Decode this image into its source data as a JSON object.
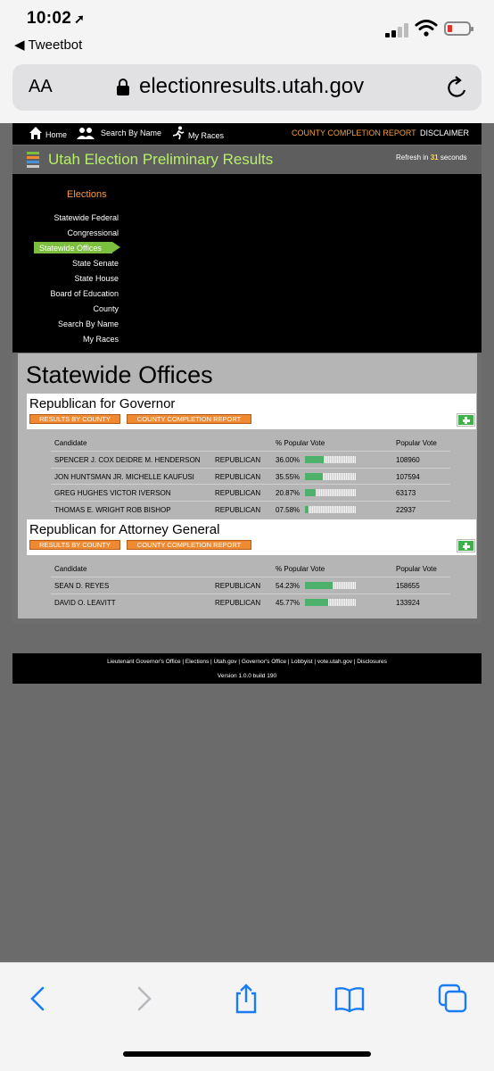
{
  "status": {
    "time": "10:02",
    "back_app": "Tweetbot"
  },
  "browser": {
    "aa": "AA",
    "url": "electionresults.utah.gov"
  },
  "nav": {
    "home": "Home",
    "search_by_name": "Search By Name",
    "my_races": "My Races",
    "county_completion": "COUNTY COMPLETION REPORT",
    "disclaimer": "DISCLAIMER"
  },
  "header": {
    "title": "Utah Election Preliminary Results",
    "refresh_prefix": "Refresh in",
    "refresh_seconds": "31",
    "refresh_suffix": "seconds"
  },
  "sidebar": {
    "heading": "Elections",
    "items": [
      {
        "label": "Statewide Federal"
      },
      {
        "label": "Congressional"
      },
      {
        "label": "Statewide Offices"
      },
      {
        "label": "State Senate"
      },
      {
        "label": "State House"
      },
      {
        "label": "Board of Education"
      },
      {
        "label": "County"
      },
      {
        "label": "Search By Name"
      },
      {
        "label": "My Races"
      }
    ],
    "active_index": 2
  },
  "main": {
    "heading": "Statewide Offices",
    "columns": {
      "candidate": "Candidate",
      "pct": "% Popular Vote",
      "votes": "Popular Vote"
    },
    "buttons": {
      "by_county": "RESULTS BY COUNTY",
      "completion": "COUNTY COMPLETION REPORT"
    },
    "races": [
      {
        "title": "Republican for Governor",
        "candidates": [
          {
            "name": "SPENCER J. COX DEIDRE M. HENDERSON",
            "party": "REPUBLICAN",
            "pct_text": "36.00%",
            "pct": 36.0,
            "votes": "108960"
          },
          {
            "name": "JON HUNTSMAN JR. MICHELLE KAUFUSI",
            "party": "REPUBLICAN",
            "pct_text": "35.55%",
            "pct": 35.55,
            "votes": "107594"
          },
          {
            "name": "GREG HUGHES VICTOR IVERSON",
            "party": "REPUBLICAN",
            "pct_text": "20.87%",
            "pct": 20.87,
            "votes": "63173"
          },
          {
            "name": "THOMAS E. WRIGHT ROB BISHOP",
            "party": "REPUBLICAN",
            "pct_text": "07.58%",
            "pct": 7.58,
            "votes": "22937"
          }
        ]
      },
      {
        "title": "Republican for Attorney General",
        "candidates": [
          {
            "name": "SEAN D. REYES",
            "party": "REPUBLICAN",
            "pct_text": "54.23%",
            "pct": 54.23,
            "votes": "158655"
          },
          {
            "name": "DAVID O. LEAVITT",
            "party": "REPUBLICAN",
            "pct_text": "45.77%",
            "pct": 45.77,
            "votes": "133924"
          }
        ]
      }
    ]
  },
  "footer": {
    "links": "Lieutenant Governor's Office | Elections | Utah.gov | Governor's Office | Lobbyist | vote.utah.gov | Disclosures",
    "version": "Version 1.0.0 build 190"
  },
  "colors": {
    "title_green": "#b6ef6a",
    "accent_orange": "#ef8a33",
    "active_green": "#7cbf3e",
    "bar_green": "#4db06b"
  },
  "icons": [
    "location-arrow-icon",
    "signal-icon",
    "wifi-icon",
    "battery-icon",
    "lock-icon",
    "reload-icon",
    "home-icon",
    "people-icon",
    "runner-icon",
    "ballot-icon",
    "plus-icon",
    "back-icon",
    "forward-icon",
    "share-icon",
    "bookmarks-icon",
    "tabs-icon"
  ]
}
